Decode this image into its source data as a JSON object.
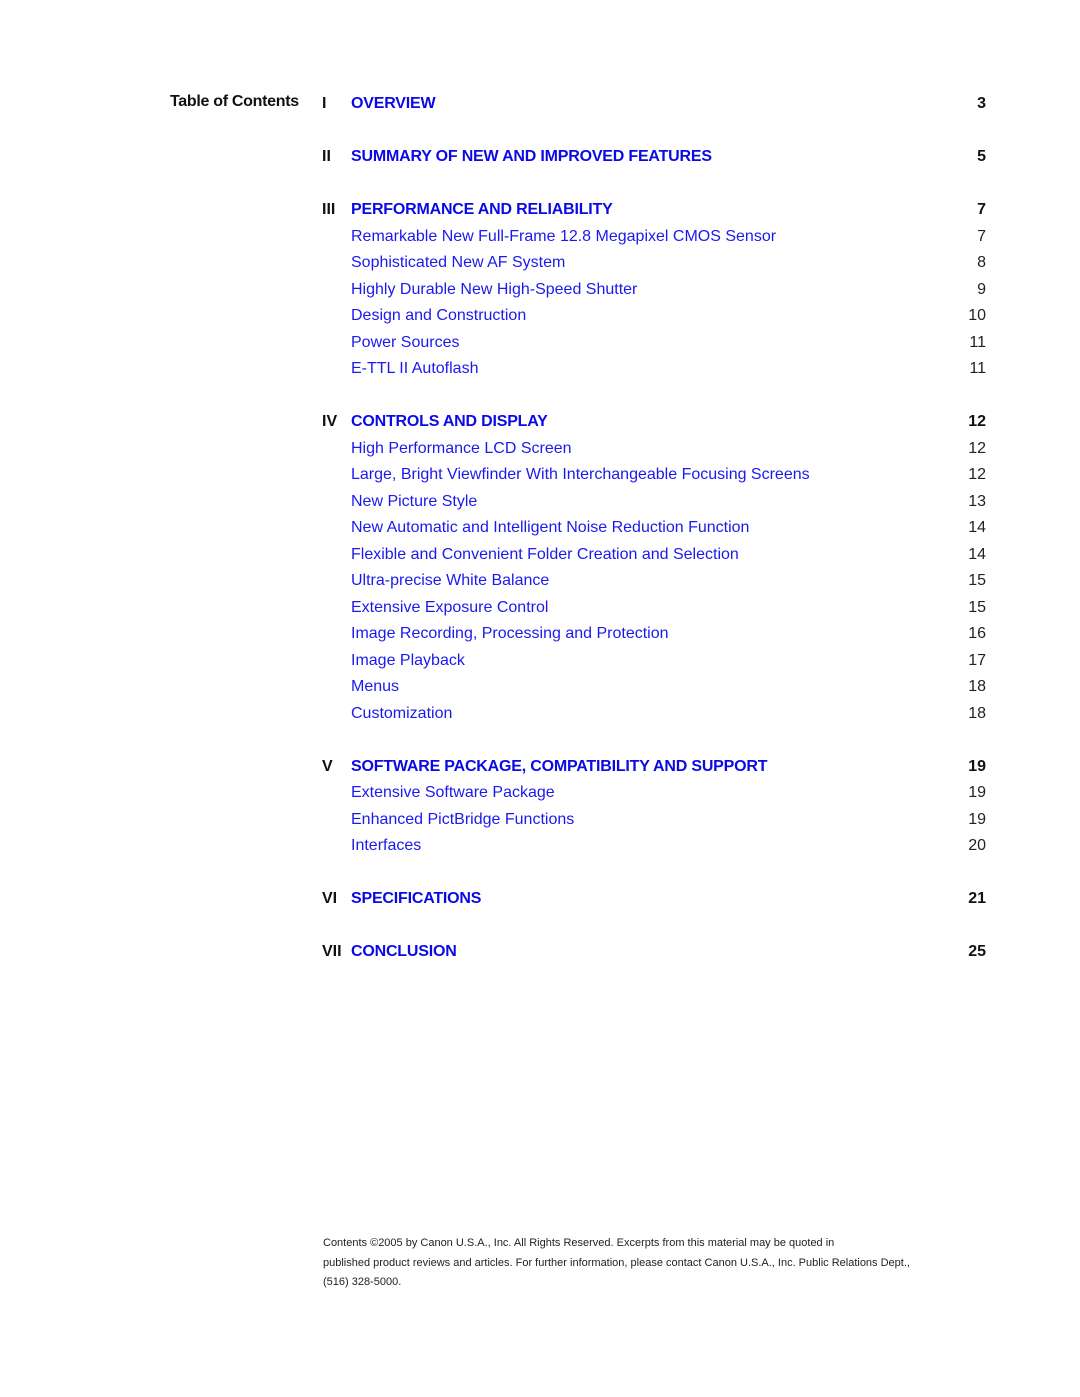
{
  "heading": "Table of Contents",
  "colors": {
    "link": "#1a1aee",
    "section_link": "#0a0ae6",
    "text": "#111111"
  },
  "sections": [
    {
      "numeral": "I",
      "title": "OVERVIEW",
      "page": "3",
      "items": []
    },
    {
      "numeral": "II",
      "title": "SUMMARY OF NEW AND IMPROVED FEATURES",
      "page": "5",
      "items": []
    },
    {
      "numeral": "III",
      "title": "PERFORMANCE AND RELIABILITY",
      "page": "7",
      "items": [
        {
          "title": "Remarkable New Full-Frame 12.8 Megapixel CMOS Sensor",
          "page": "7"
        },
        {
          "title": "Sophisticated New AF System",
          "page": "8"
        },
        {
          "title": "Highly Durable New High-Speed Shutter",
          "page": "9"
        },
        {
          "title": "Design and Construction",
          "page": "10"
        },
        {
          "title": "Power Sources",
          "page": "11"
        },
        {
          "title": "E-TTL II Autoflash",
          "page": "11"
        }
      ]
    },
    {
      "numeral": "IV",
      "title": "CONTROLS AND DISPLAY",
      "page": "12",
      "items": [
        {
          "title": "High Performance LCD Screen",
          "page": "12"
        },
        {
          "title": "Large, Bright Viewfinder With Interchangeable Focusing Screens",
          "page": "12"
        },
        {
          "title": "New Picture Style",
          "page": "13"
        },
        {
          "title": "New Automatic and Intelligent Noise Reduction Function",
          "page": "14"
        },
        {
          "title": "Flexible and Convenient Folder Creation and Selection",
          "page": "14"
        },
        {
          "title": "Ultra-precise White Balance",
          "page": "15"
        },
        {
          "title": "Extensive Exposure Control",
          "page": "15"
        },
        {
          "title": "Image Recording, Processing and Protection",
          "page": "16"
        },
        {
          "title": "Image Playback",
          "page": "17"
        },
        {
          "title": "Menus",
          "page": "18"
        },
        {
          "title": "Customization",
          "page": "18"
        }
      ]
    },
    {
      "numeral": "V",
      "title": "SOFTWARE PACKAGE, COMPATIBILITY AND SUPPORT",
      "page": "19",
      "items": [
        {
          "title": "Extensive Software Package",
          "page": "19"
        },
        {
          "title": "Enhanced PictBridge Functions",
          "page": "19"
        },
        {
          "title": "Interfaces",
          "page": "20"
        }
      ]
    },
    {
      "numeral": "VI",
      "title": "SPECIFICATIONS",
      "page": "21",
      "items": []
    },
    {
      "numeral": "VII",
      "title": "CONCLUSION",
      "page": "25",
      "items": []
    }
  ],
  "footer": {
    "line1": "Contents ©2005 by Canon U.S.A., Inc.  All Rights Reserved.  Excerpts from this material may be quoted in",
    "line2": "published product reviews and articles.  For further information, please contact Canon U.S.A., Inc. Public Relations Dept.,",
    "line3": "(516) 328-5000."
  }
}
